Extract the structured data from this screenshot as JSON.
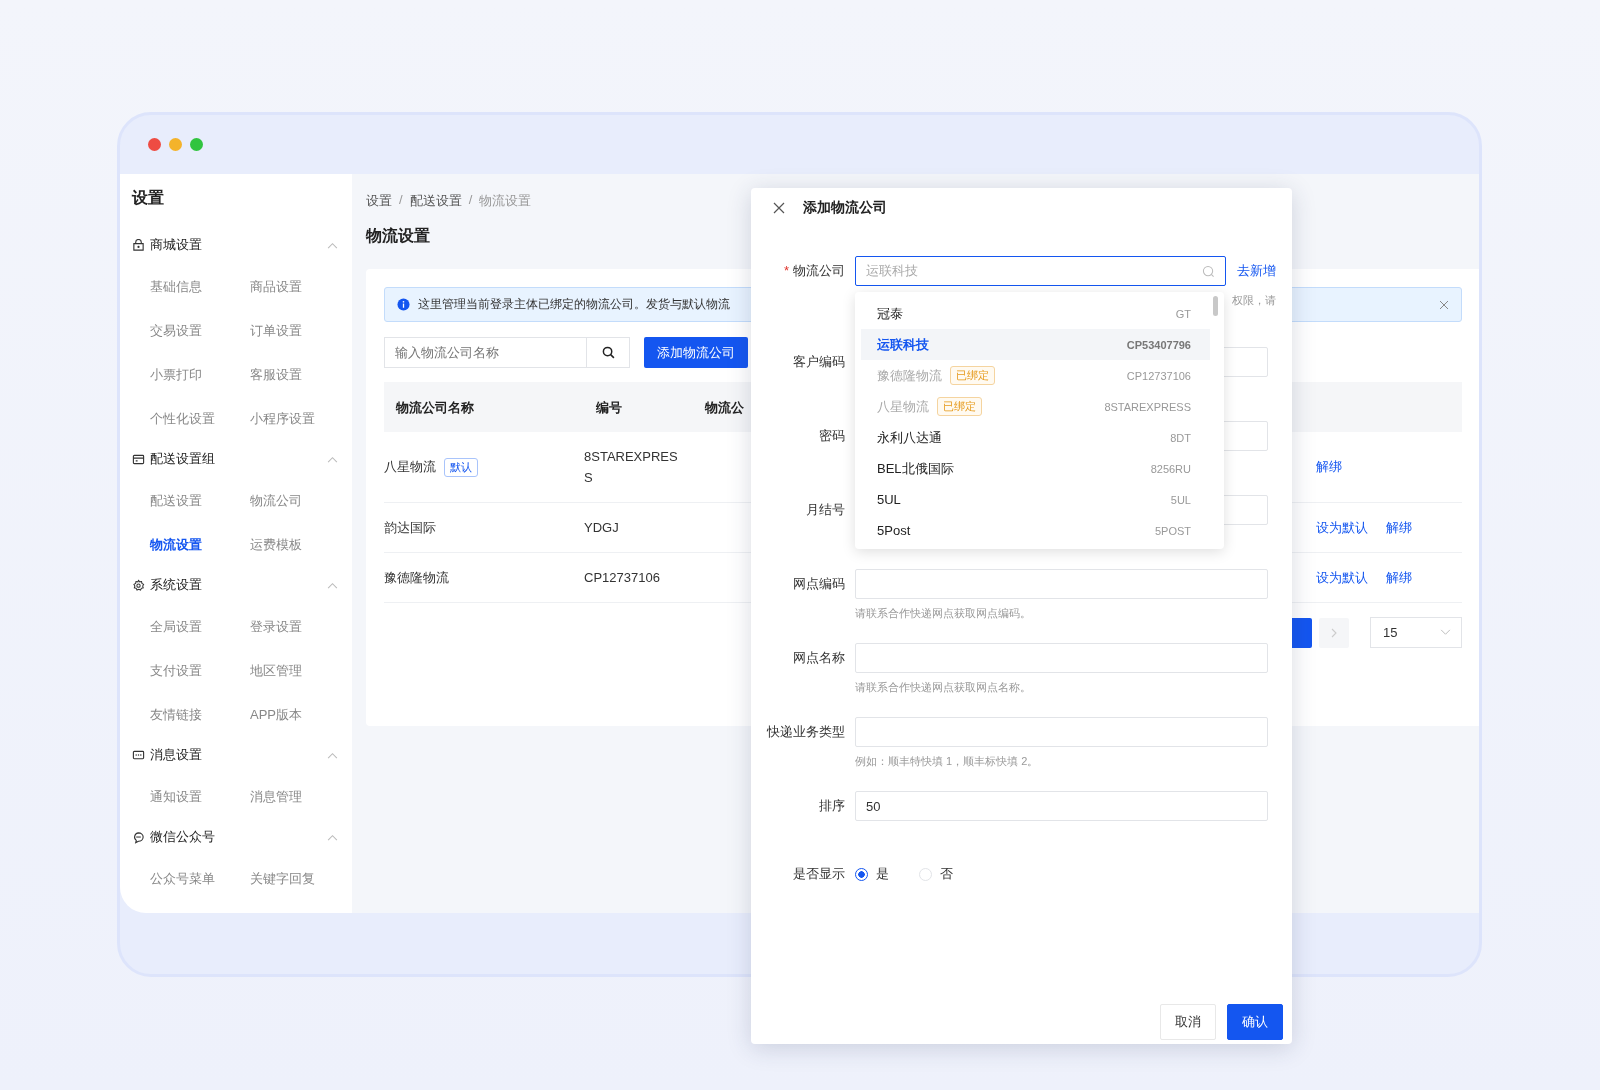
{
  "sidebar": {
    "title": "设置",
    "groups": [
      {
        "label": "商城设置",
        "expanded": true,
        "items": [
          {
            "label": "基础信息",
            "selected": false
          },
          {
            "label": "商品设置",
            "selected": false
          },
          {
            "label": "交易设置",
            "selected": false
          },
          {
            "label": "订单设置",
            "selected": false
          },
          {
            "label": "小票打印",
            "selected": false
          },
          {
            "label": "客服设置",
            "selected": false
          },
          {
            "label": "个性化设置",
            "selected": false
          },
          {
            "label": "小程序设置",
            "selected": false
          }
        ]
      },
      {
        "label": "配送设置组",
        "expanded": true,
        "items": [
          {
            "label": "配送设置",
            "selected": false
          },
          {
            "label": "物流公司",
            "selected": false
          },
          {
            "label": "物流设置",
            "selected": true
          },
          {
            "label": "运费模板",
            "selected": false
          }
        ]
      },
      {
        "label": "系统设置",
        "expanded": true,
        "items": [
          {
            "label": "全局设置",
            "selected": false
          },
          {
            "label": "登录设置",
            "selected": false
          },
          {
            "label": "支付设置",
            "selected": false
          },
          {
            "label": "地区管理",
            "selected": false
          },
          {
            "label": "友情链接",
            "selected": false
          },
          {
            "label": "APP版本",
            "selected": false
          }
        ]
      },
      {
        "label": "消息设置",
        "expanded": true,
        "items": [
          {
            "label": "通知设置",
            "selected": false
          },
          {
            "label": "消息管理",
            "selected": false
          }
        ]
      },
      {
        "label": "微信公众号",
        "expanded": true,
        "items": [
          {
            "label": "公众号菜单",
            "selected": false
          },
          {
            "label": "关键字回复",
            "selected": false
          }
        ]
      }
    ]
  },
  "main": {
    "breadcrumb": [
      "设置",
      "配送设置",
      "物流设置"
    ],
    "breadcrumb_separator": "/",
    "title": "物流设置",
    "alert": {
      "text": "这里管理当前登录主体已绑定的物流公司。发货与默认物流"
    },
    "search": {
      "placeholder": "输入物流公司名称"
    },
    "add_button": "添加物流公司",
    "table": {
      "columns": [
        "物流公司名称",
        "编号",
        "物流公"
      ],
      "rows": [
        {
          "name": "八星物流",
          "tag": "默认",
          "code": "8STAREXPRESS",
          "actions": [
            "解绑"
          ]
        },
        {
          "name": "韵达国际",
          "code": "YDGJ",
          "actions": [
            "设为默认",
            "解绑"
          ]
        },
        {
          "name": "豫德隆物流",
          "code": "CP12737106",
          "actions": [
            "设为默认",
            "解绑"
          ]
        }
      ]
    },
    "pagination": {
      "page_size": "15"
    }
  },
  "dialog": {
    "title": "添加物流公司",
    "required_mark": "*",
    "fields": [
      {
        "label": "物流公司",
        "required": true,
        "kind": "select",
        "focused": true,
        "placeholder": "运联科技",
        "link": "去新增",
        "hint": "权限，请"
      },
      {
        "label": "客户编码",
        "required": false,
        "kind": "input"
      },
      {
        "label": "密码",
        "required": false,
        "kind": "input"
      },
      {
        "label": "月结号",
        "required": false,
        "kind": "input"
      },
      {
        "label": "网点编码",
        "required": false,
        "kind": "input",
        "hint": "请联系合作快递网点获取网点编码。"
      },
      {
        "label": "网点名称",
        "required": false,
        "kind": "input",
        "hint": "请联系合作快递网点获取网点名称。"
      },
      {
        "label": "快递业务类型",
        "required": false,
        "kind": "input",
        "hint": "例如：顺丰特快填 1，顺丰标快填 2。"
      },
      {
        "label": "排序",
        "required": false,
        "kind": "input",
        "value": "50"
      }
    ],
    "radio": {
      "label": "是否显示",
      "options": [
        {
          "label": "是",
          "selected": true
        },
        {
          "label": "否",
          "selected": false
        }
      ]
    },
    "dropdown": [
      {
        "name": "冠泰",
        "code": "GT",
        "selected": false,
        "disabled": false
      },
      {
        "name": "运联科技",
        "code": "CP53407796",
        "selected": true,
        "disabled": false
      },
      {
        "name": "豫德隆物流",
        "code": "CP12737106",
        "selected": false,
        "disabled": true,
        "tag": "已绑定"
      },
      {
        "name": "八星物流",
        "code": "8STAREXPRESS",
        "selected": false,
        "disabled": true,
        "tag": "已绑定"
      },
      {
        "name": "永利八达通",
        "code": "8DT",
        "selected": false,
        "disabled": false
      },
      {
        "name": "BEL北俄国际",
        "code": "8256RU",
        "selected": false,
        "disabled": false
      },
      {
        "name": "5UL",
        "code": "5UL",
        "selected": false,
        "disabled": false
      },
      {
        "name": "5Post",
        "code": "5POST",
        "selected": false,
        "disabled": false
      }
    ],
    "buttons": [
      {
        "label": "取消",
        "kind": "default"
      },
      {
        "label": "确认",
        "kind": "primary"
      }
    ]
  }
}
